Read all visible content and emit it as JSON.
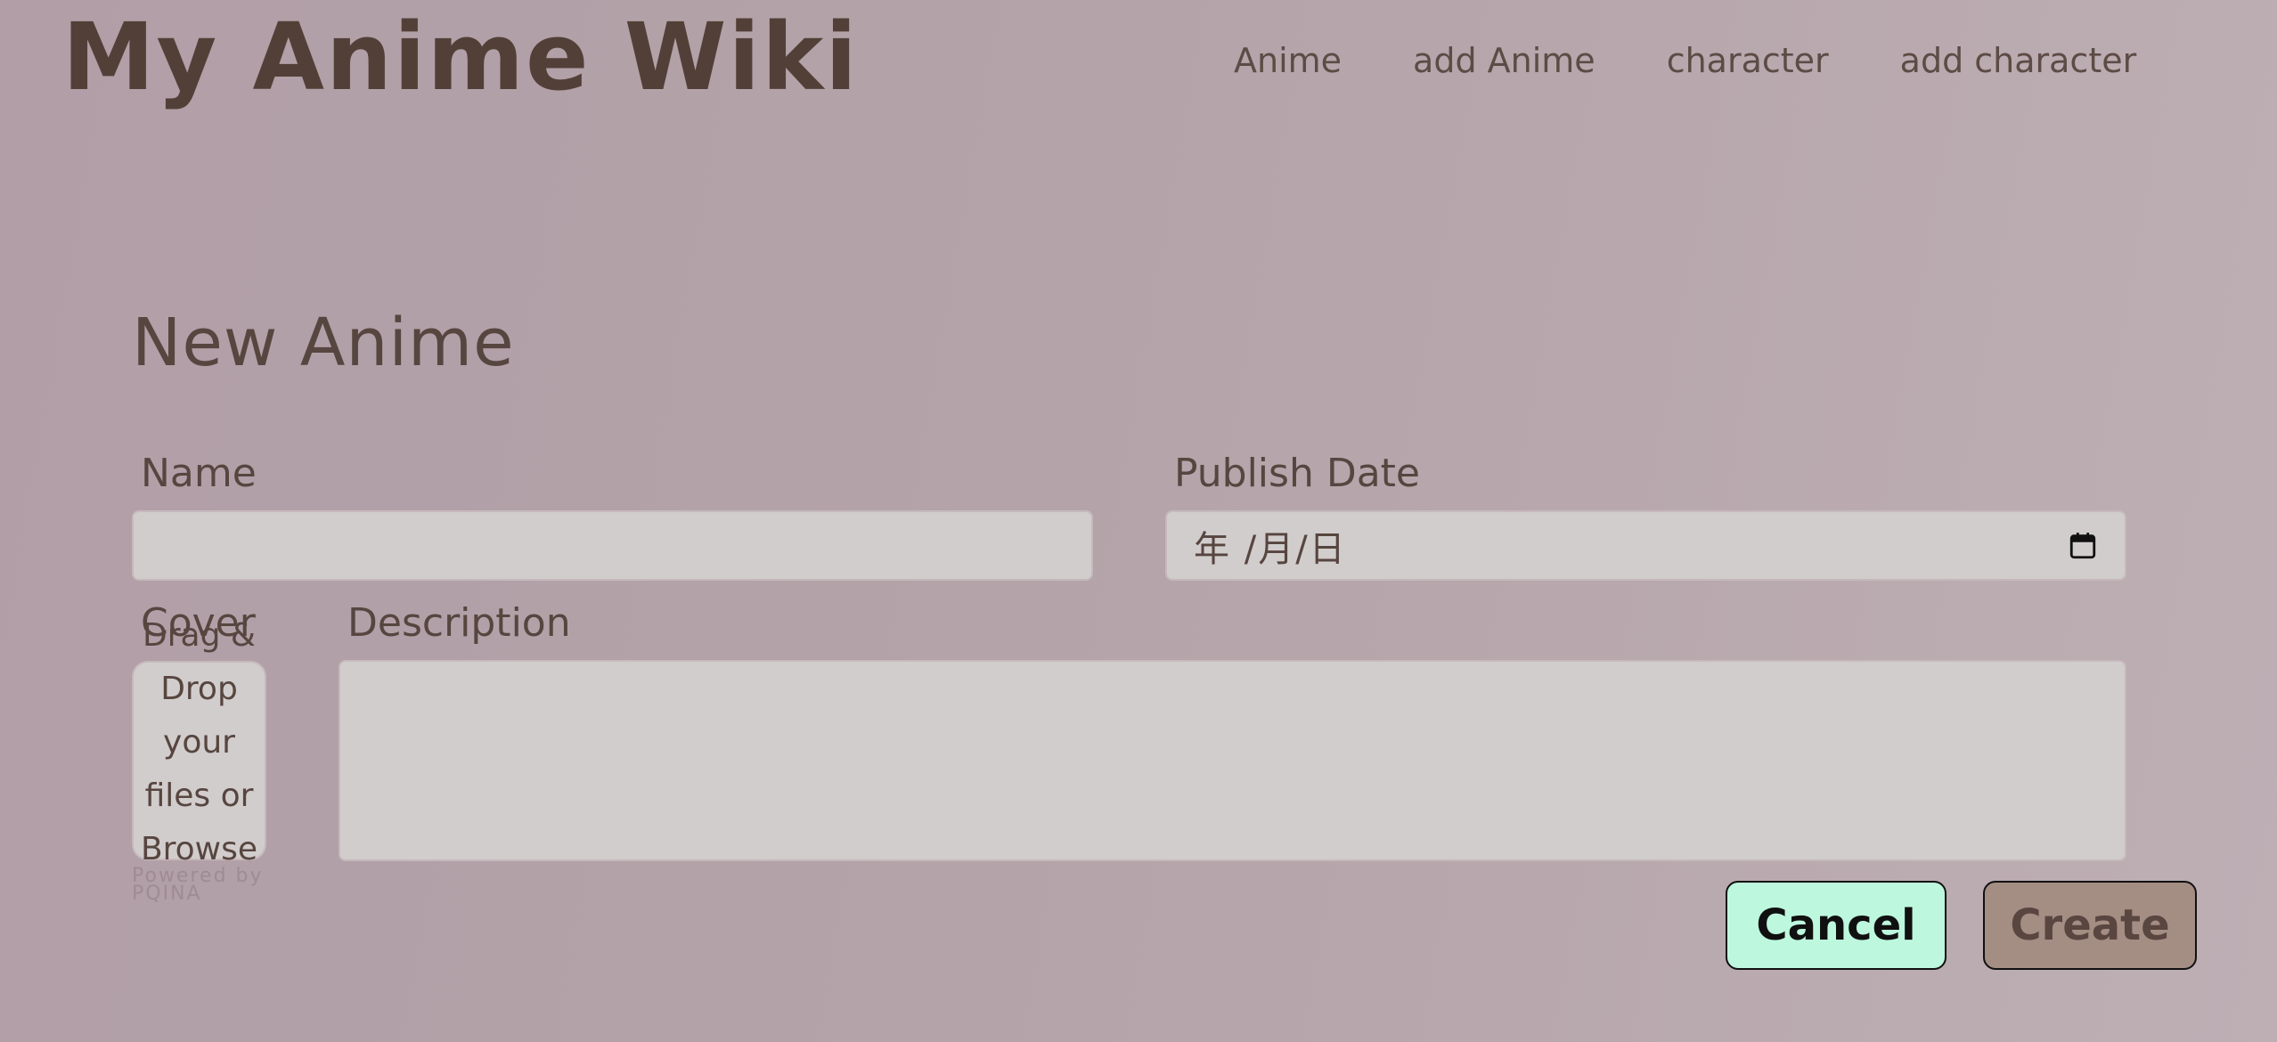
{
  "header": {
    "site_title": "My Anime Wiki",
    "nav": [
      "Anime",
      "add Anime",
      "character",
      "add character"
    ]
  },
  "form": {
    "title": "New Anime",
    "name_label": "Name",
    "name_value": "",
    "publish_date_label": "Publish Date",
    "publish_date_placeholder": "年 /月/日",
    "cover_label": "Cover",
    "cover_drop_text": "Drag & Drop your files or Browse",
    "cover_powered_by": "Powered by PQINA",
    "description_label": "Description",
    "description_value": ""
  },
  "actions": {
    "cancel_label": "Cancel",
    "create_label": "Create"
  },
  "colors": {
    "title_text": "#524038",
    "field_bg": "#d1cdcc",
    "cancel_bg": "#bdf7de",
    "create_bg": "#a48d83"
  },
  "icons": {
    "date_picker": "calendar-icon"
  }
}
